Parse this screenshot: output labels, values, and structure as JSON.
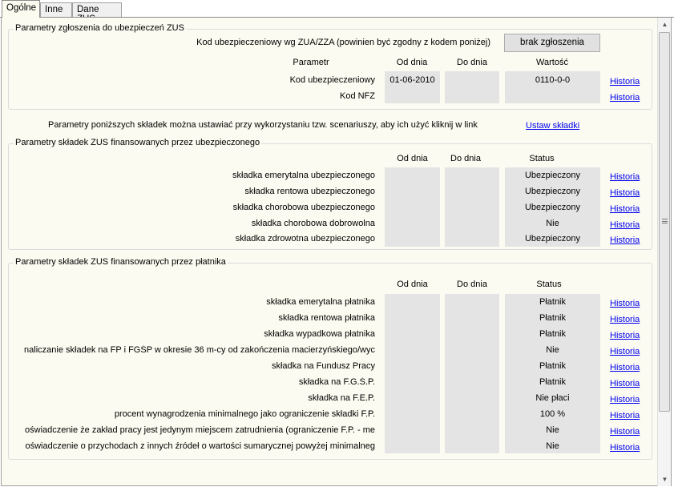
{
  "tabs": [
    "Ogólne",
    "Inne",
    "Dane ZUS"
  ],
  "zgloszenie": {
    "legend": "Parametry zgłoszenia do ubezpieczeń ZUS",
    "kod_label": "Kod ubezpieczeniowy wg ZUA/ZZA (powinien być zgodny z kodem poniżej)",
    "brak_button": "brak zgłoszenia",
    "headers": [
      "Parametr",
      "Od dnia",
      "Do dnia",
      "Wartość"
    ],
    "rows": [
      {
        "label": "Kod ubezpieczeniowy",
        "od": "01-06-2010",
        "do": "",
        "value": "0110-0-0",
        "link": "Historia"
      },
      {
        "label": "Kod NFZ",
        "od": "",
        "do": "",
        "value": "",
        "link": "Historia"
      }
    ]
  },
  "scenariusze": {
    "text": "Parametry poniższych składek można ustawiać przy wykorzystaniu tzw. scenariuszy, aby ich użyć kliknij w link",
    "link": "Ustaw składki"
  },
  "ubezpieczony": {
    "legend": "Parametry składek ZUS finansowanych przez ubezpieczonego",
    "headers": [
      "Od dnia",
      "Do dnia",
      "Status"
    ],
    "rows": [
      {
        "label": "składka emerytalna ubezpieczonego",
        "status": "Ubezpieczony",
        "link": "Historia"
      },
      {
        "label": "składka rentowa ubezpieczonego",
        "status": "Ubezpieczony",
        "link": "Historia"
      },
      {
        "label": "składka chorobowa ubezpieczonego",
        "status": "Ubezpieczony",
        "link": "Historia"
      },
      {
        "label": "składka chorobowa dobrowolna",
        "status": "Nie",
        "link": "Historia"
      },
      {
        "label": "składka zdrowotna ubezpieczonego",
        "status": "Ubezpieczony",
        "link": "Historia"
      }
    ]
  },
  "platnik": {
    "legend": "Parametry składek ZUS finansowanych przez płatnika",
    "headers": [
      "Od dnia",
      "Do dnia",
      "Status"
    ],
    "rows": [
      {
        "label": "składka emerytalna płatnika",
        "status": "Płatnik",
        "link": "Historia"
      },
      {
        "label": "składka rentowa płatnika",
        "status": "Płatnik",
        "link": "Historia"
      },
      {
        "label": "składka wypadkowa płatnika",
        "status": "Płatnik",
        "link": "Historia"
      },
      {
        "label": "naliczanie składek na FP i FGŚP w okresie 36 m-cy od zakończenia macierzyńskiego/wyc",
        "status": "Nie",
        "link": "Historia"
      },
      {
        "label": "składka na Fundusz Pracy",
        "status": "Płatnik",
        "link": "Historia"
      },
      {
        "label": "składka na F.G.Ś.P.",
        "status": "Płatnik",
        "link": "Historia"
      },
      {
        "label": "składka na F.E.P.",
        "status": "Nie płaci",
        "link": "Historia"
      },
      {
        "label": "procent wynagrodzenia minimalnego jako ograniczenie składki F.P.",
        "status": "100 %",
        "link": "Historia"
      },
      {
        "label": "oświadczenie że zakład pracy jest jedynym miejscem zatrudnienia (ograniczenie F.P. - me",
        "status": "Nie",
        "link": "Historia"
      },
      {
        "label": "oświadczenie o przychodach z innych źródeł o wartości sumarycznej powyżej minimalneg",
        "status": "Nie",
        "link": "Historia"
      }
    ]
  }
}
